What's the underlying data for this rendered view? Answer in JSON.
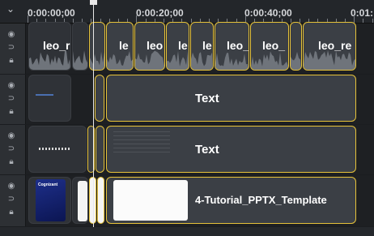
{
  "ruler": {
    "collapse_icon": "chevron-down-icon",
    "timecodes": [
      "0:00:00;00",
      "0:00:20;00",
      "0:00:40;00",
      "0:01:"
    ]
  },
  "tracks": [
    {
      "name": "track-1-audio",
      "clips": [
        "leo_r",
        "",
        "le",
        "leo",
        "le",
        "le",
        "leo_",
        "leo_",
        "",
        "leo_re"
      ]
    },
    {
      "name": "track-2-text",
      "clips": [
        "",
        "",
        "Text"
      ]
    },
    {
      "name": "track-3-text",
      "clips": [
        "",
        "",
        "",
        "Text"
      ]
    },
    {
      "name": "track-4-slides",
      "clips": [
        "",
        "",
        "",
        "4-Tutorial_PPTX_Template"
      ],
      "thumb_brand": "Cognizant"
    }
  ],
  "track_header_icons": [
    "eye-icon",
    "unlink-icon",
    "lock-icon"
  ],
  "colors": {
    "selection": "#e6c23a",
    "clip": "#3b3f45",
    "background": "#1b1d20"
  }
}
